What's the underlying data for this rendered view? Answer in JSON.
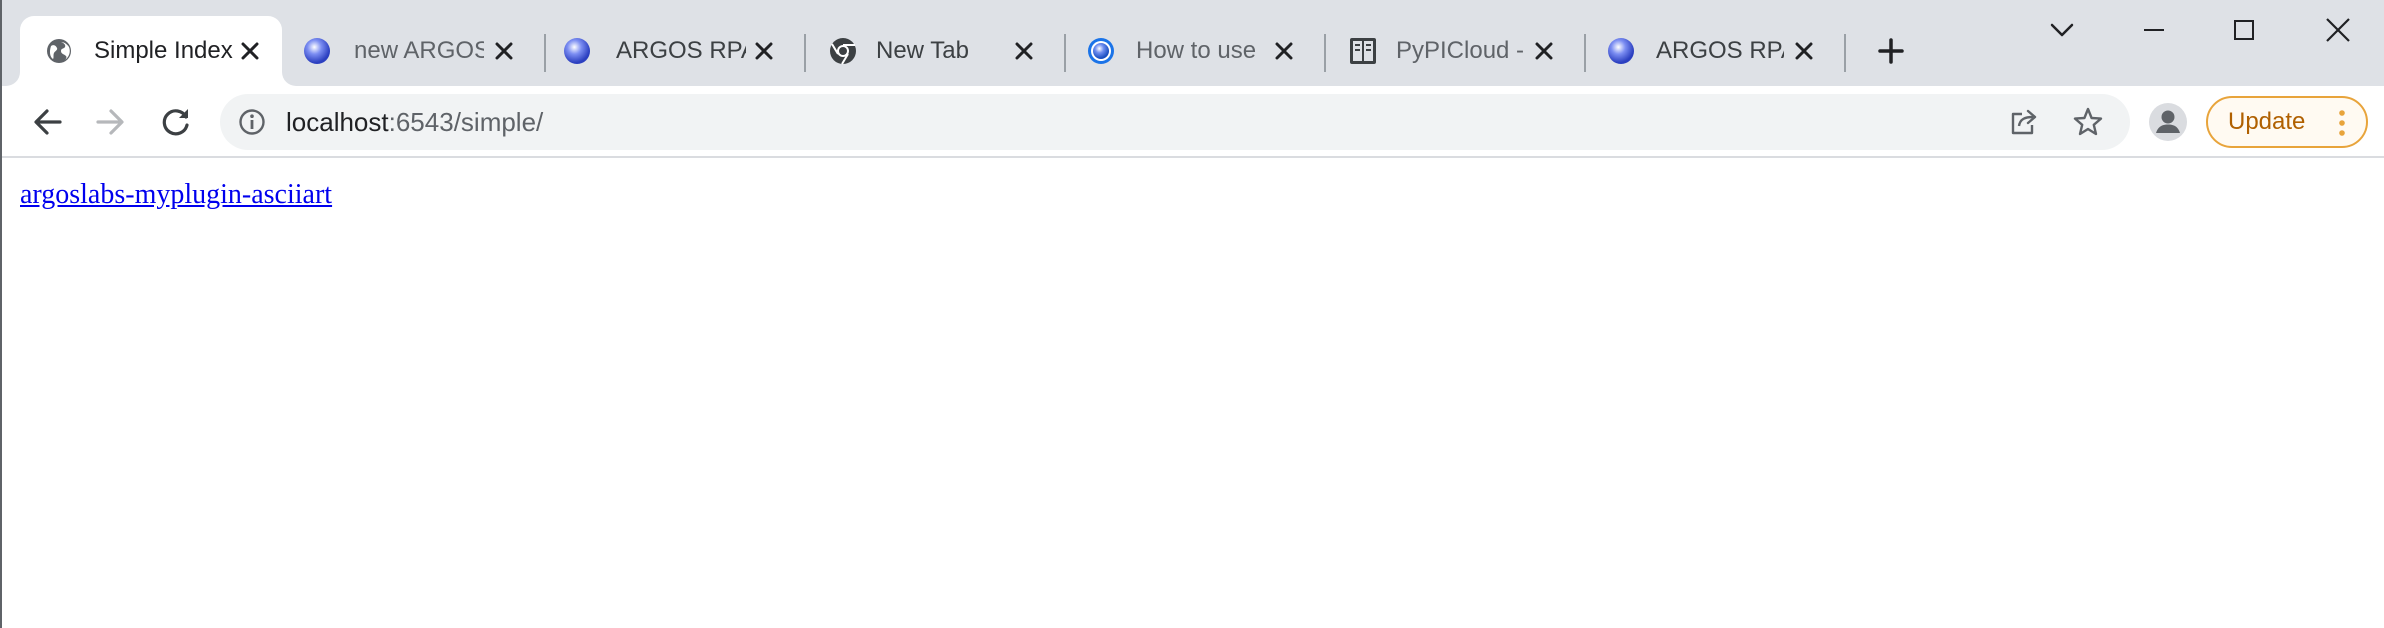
{
  "tabs": [
    {
      "title": "Simple Index",
      "favicon": "globe-icon",
      "active": true
    },
    {
      "title": "new ARGOS",
      "favicon": "argos-orb-icon",
      "active": false
    },
    {
      "title": "ARGOS RPA",
      "favicon": "argos-orb-icon",
      "active": false
    },
    {
      "title": "New Tab",
      "favicon": "chrome-icon",
      "active": false
    },
    {
      "title": "How to use",
      "favicon": "argos-orb-icon",
      "active": false
    },
    {
      "title": "PyPICloud -",
      "favicon": "pypicloud-icon",
      "active": false
    },
    {
      "title": "ARGOS RPA",
      "favicon": "argos-orb-icon",
      "active": false
    }
  ],
  "address_bar": {
    "host": "localhost",
    "path": ":6543/simple/"
  },
  "toolbar": {
    "update_label": "Update"
  },
  "page": {
    "links": [
      {
        "text": "argoslabs-myplugin-asciiart"
      }
    ]
  },
  "colors": {
    "tabstrip_bg": "#dee1e6",
    "link": "#0000ee",
    "update_accent": "#e8a43b"
  }
}
